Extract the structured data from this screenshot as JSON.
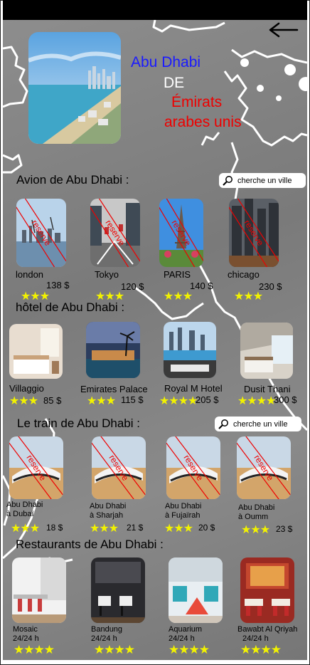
{
  "header": {
    "title_line1": "Abu Dhabi",
    "title_line2": "DE",
    "title_line3": "Émirats",
    "title_line4": "arabes unis"
  },
  "icons": {
    "back": "arrow-left-icon",
    "search": "magnifier-icon",
    "star": "★"
  },
  "colors": {
    "title_blue": "#1a1aff",
    "title_red": "#e00000",
    "star": "#f2f200",
    "reserve": "#e00000"
  },
  "flights": {
    "title": "Avion de Abu Dhabi  :",
    "search_label": "cherche un ville",
    "reserve_label": "reserve",
    "items": [
      {
        "name": "london",
        "price": "138 $",
        "stars": "★★★"
      },
      {
        "name": "Tokyo",
        "price": "120 $",
        "stars": "★★★"
      },
      {
        "name": "PARIS",
        "price": "140 $",
        "stars": "★★★"
      },
      {
        "name": "chicago",
        "price": "230 $",
        "stars": "★★★"
      }
    ]
  },
  "hotels": {
    "title": "hôtel de Abu Dhabi :",
    "items": [
      {
        "name": "Villaggio",
        "price": "85 $",
        "stars": "★★★"
      },
      {
        "name": "Emirates Palace",
        "price": "115 $",
        "stars": "★★★"
      },
      {
        "name": "Royal M Hotel",
        "price": "205 $",
        "stars": "★★★★"
      },
      {
        "name": "Dusit Thani",
        "price": "300 $",
        "stars": "★★★★"
      }
    ]
  },
  "trains": {
    "title": "Le train de Abu Dhabi :",
    "search_label": "cherche un ville",
    "reserve_label": "reserve",
    "items": [
      {
        "line1": "Abu Dhabi",
        "line2": "à Dubaï",
        "price": "18 $",
        "stars": "★★★"
      },
      {
        "line1": "Abu Dhabi",
        "line2": "à Sharjah",
        "price": "21 $",
        "stars": "★★★"
      },
      {
        "line1": "Abu Dhabi",
        "line2": "à Fujaïrah",
        "price": "20 $",
        "stars": "★★★"
      },
      {
        "line1": "Abu Dhabi",
        "line2": "à  Oumm",
        "price": "23 $",
        "stars": "★★★"
      }
    ]
  },
  "restaurants": {
    "title": "Restaurants de Abu Dhabi :",
    "items": [
      {
        "name": "Mosaic",
        "hours": "24/24 h",
        "stars": "★★★★"
      },
      {
        "name": "Bandung",
        "hours": "24/24 h",
        "stars": "★★★★"
      },
      {
        "name": "Aquarium",
        "hours": "24/24 h",
        "stars": "★★★★"
      },
      {
        "name": "Bawabt Al Qriyah",
        "hours": "24/24 h",
        "stars": "★★★★"
      }
    ]
  }
}
